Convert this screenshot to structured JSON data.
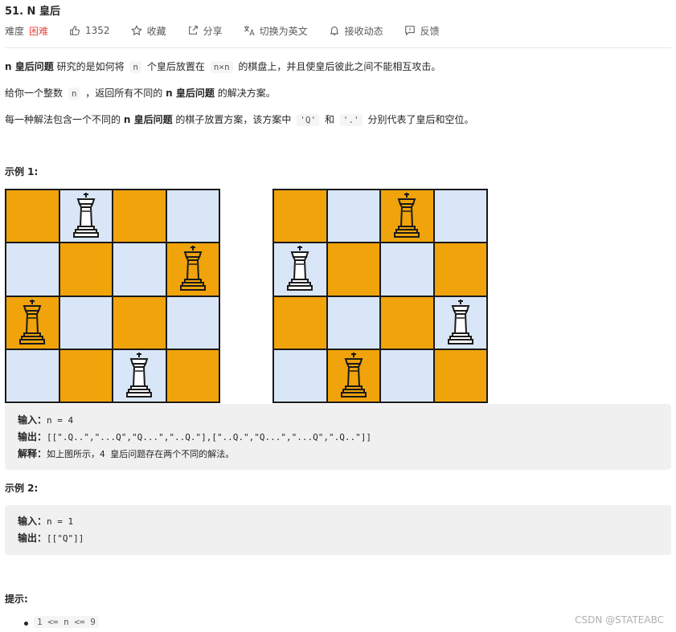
{
  "problem": {
    "title": "51. N 皇后"
  },
  "meta": {
    "difficulty_label": "难度",
    "difficulty": "困难",
    "likes": "1352",
    "favorite": "收藏",
    "share": "分享",
    "switch_lang": "切换为英文",
    "subscribe": "接收动态",
    "feedback": "反馈",
    "difficulty_color": "#ef4743"
  },
  "description": {
    "p1": {
      "bold1": "n 皇后问题",
      "t1": "研究的是如何将",
      "code1": "n",
      "t2": "个皇后放置在",
      "code2": "n×n",
      "t3": "的棋盘上，并且使皇后彼此之间不能相互攻击。"
    },
    "p2": {
      "t1": "给你一个整数",
      "code1": "n",
      "t2": "，返回所有不同的",
      "bold1": "n 皇后问题",
      "t3": "的解决方案。"
    },
    "p3": {
      "t1": "每一种解法包含一个不同的",
      "bold1": "n 皇后问题",
      "t2": "的棋子放置方案，该方案中",
      "code1": "'Q'",
      "t3": "和",
      "code2": "'.'",
      "t4": "分别代表了皇后和空位。"
    }
  },
  "example1": {
    "heading": "示例 1:",
    "boards": [
      {
        "queens": [
          1,
          3,
          0,
          2
        ]
      },
      {
        "queens": [
          2,
          0,
          3,
          1
        ]
      }
    ],
    "colors": {
      "dark": "#f0a30a",
      "light": "#d9e6f7"
    },
    "input_label": "输入：",
    "input_value": "n = 4",
    "output_label": "输出：",
    "output_value": "[[\".Q..\",\"...Q\",\"Q...\",\"..Q.\"],[\"..Q.\",\"Q...\",\"...Q\",\".Q..\"]]",
    "explain_label": "解释：",
    "explain_value": "如上图所示，4 皇后问题存在两个不同的解法。"
  },
  "example2": {
    "heading": "示例 2:",
    "input_label": "输入：",
    "input_value": "n = 1",
    "output_label": "输出：",
    "output_value": "[[\"Q\"]]"
  },
  "hints": {
    "heading": "提示:",
    "items": [
      "1 <= n <= 9"
    ]
  },
  "watermark": "CSDN @STATEABC"
}
